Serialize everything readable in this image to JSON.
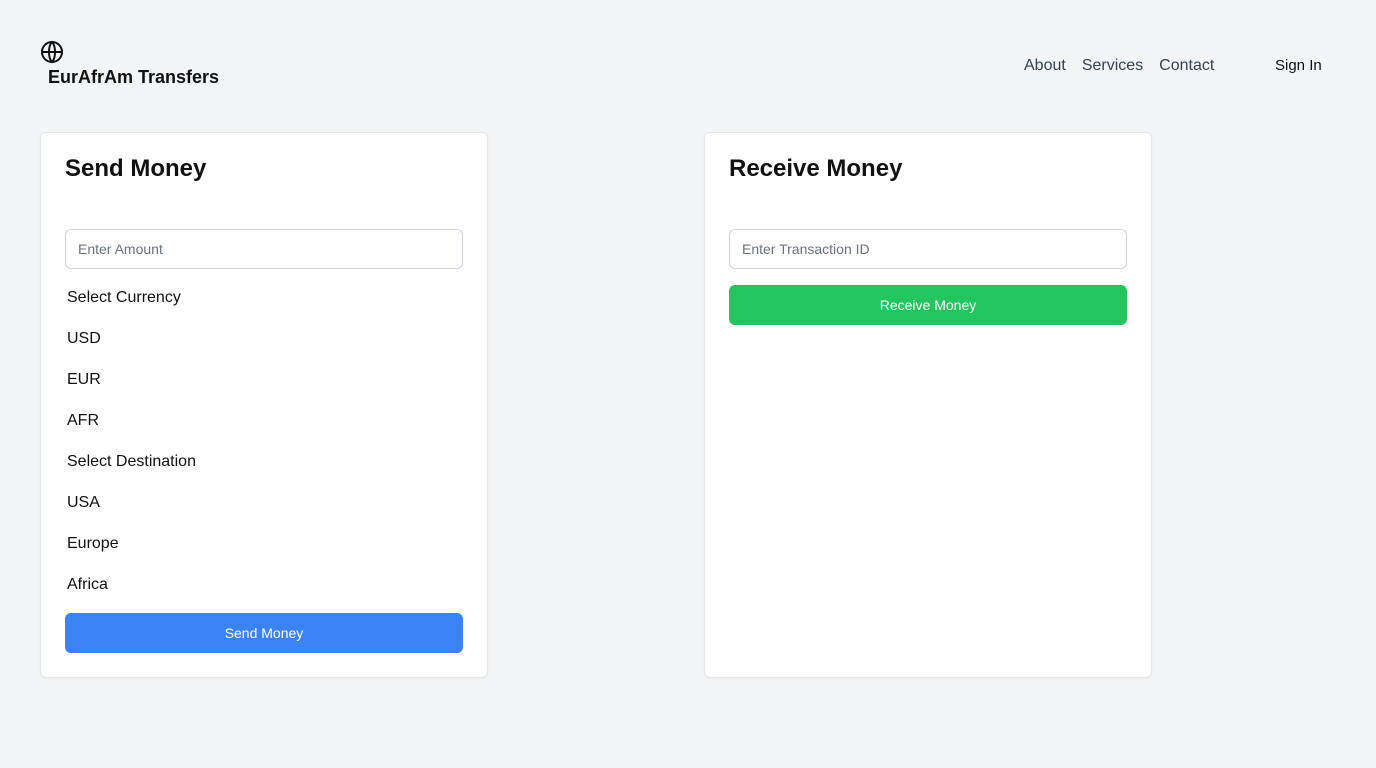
{
  "brand": {
    "name": "EurAfrAm Transfers",
    "icon": "globe-icon"
  },
  "nav": {
    "links": [
      "About",
      "Services",
      "Contact"
    ],
    "sign_in": "Sign In"
  },
  "send": {
    "title": "Send Money",
    "amount_placeholder": "Enter Amount",
    "currency_options": [
      "Select Currency",
      "USD",
      "EUR",
      "AFR"
    ],
    "destination_options": [
      "Select Destination",
      "USA",
      "Europe",
      "Africa"
    ],
    "button_label": "Send Money",
    "button_color": "#3b82f6"
  },
  "receive": {
    "title": "Receive Money",
    "transaction_placeholder": "Enter Transaction ID",
    "button_label": "Receive Money",
    "button_color": "#22c55e"
  }
}
